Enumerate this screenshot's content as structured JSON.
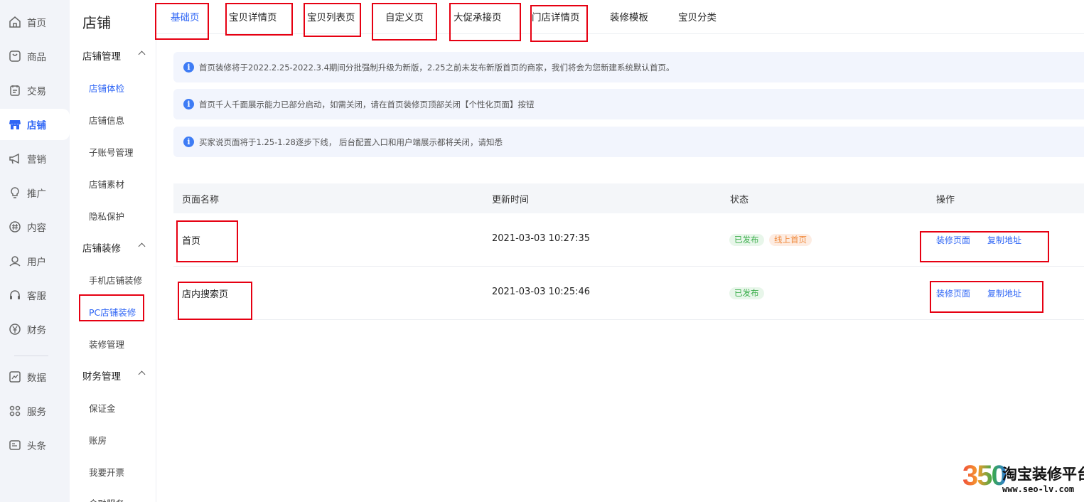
{
  "nav": {
    "items": [
      {
        "label": "首页",
        "icon": "home-icon"
      },
      {
        "label": "商品",
        "icon": "goods-icon"
      },
      {
        "label": "交易",
        "icon": "order-icon"
      },
      {
        "label": "店铺",
        "icon": "shop-icon",
        "active": true
      },
      {
        "label": "营销",
        "icon": "megaphone-icon"
      },
      {
        "label": "推广",
        "icon": "lightbulb-icon"
      },
      {
        "label": "内容",
        "icon": "hash-icon"
      },
      {
        "label": "用户",
        "icon": "user-icon"
      },
      {
        "label": "客服",
        "icon": "headset-icon"
      },
      {
        "label": "财务",
        "icon": "yen-icon"
      },
      {
        "label": "数据",
        "icon": "chart-icon"
      },
      {
        "label": "服务",
        "icon": "grid-icon"
      },
      {
        "label": "头条",
        "icon": "news-icon"
      }
    ]
  },
  "sidebar": {
    "title": "店铺",
    "sections": [
      {
        "label": "店铺管理",
        "items": [
          "店铺体检",
          "店铺信息",
          "子账号管理",
          "店铺素材",
          "隐私保护"
        ]
      },
      {
        "label": "店铺装修",
        "items": [
          "手机店铺装修",
          "PC店铺装修",
          "装修管理"
        ]
      },
      {
        "label": "财务管理",
        "items": [
          "保证金",
          "账房",
          "我要开票",
          "金融服务"
        ]
      }
    ]
  },
  "tabs": [
    "基础页",
    "宝贝详情页",
    "宝贝列表页",
    "自定义页",
    "大促承接页",
    "门店详情页",
    "装修模板",
    "宝贝分类"
  ],
  "notices": [
    "首页装修将于2022.2.25-2022.3.4期间分批强制升级为新版，2.25之前未发布新版首页的商家，我们将会为您新建系统默认首页。",
    "首页千人千面展示能力已部分启动，如需关闭，请在首页装修页顶部关闭【个性化页面】按钮",
    "买家说页面将于1.25-1.28逐步下线，  后台配置入口和用户端展示都将关闭，请知悉"
  ],
  "table": {
    "headers": [
      "页面名称",
      "更新时间",
      "状态",
      "操作"
    ],
    "rows": [
      {
        "name": "首页",
        "time": "2021-03-03 10:27:35",
        "status": [
          "已发布",
          "线上首页"
        ],
        "actions": [
          "装修页面",
          "复制地址"
        ]
      },
      {
        "name": "店内搜索页",
        "time": "2021-03-03 10:25:46",
        "status": [
          "已发布"
        ],
        "actions": [
          "装修页面",
          "复制地址"
        ]
      }
    ]
  },
  "watermark": {
    "number": "350",
    "title": "淘宝装修平台",
    "url": "www.seo-lv.com"
  },
  "colors": {
    "accent": "#2f66f5",
    "annotation": "#e60012",
    "published": "#3bae4b",
    "online": "#f08a3c"
  }
}
